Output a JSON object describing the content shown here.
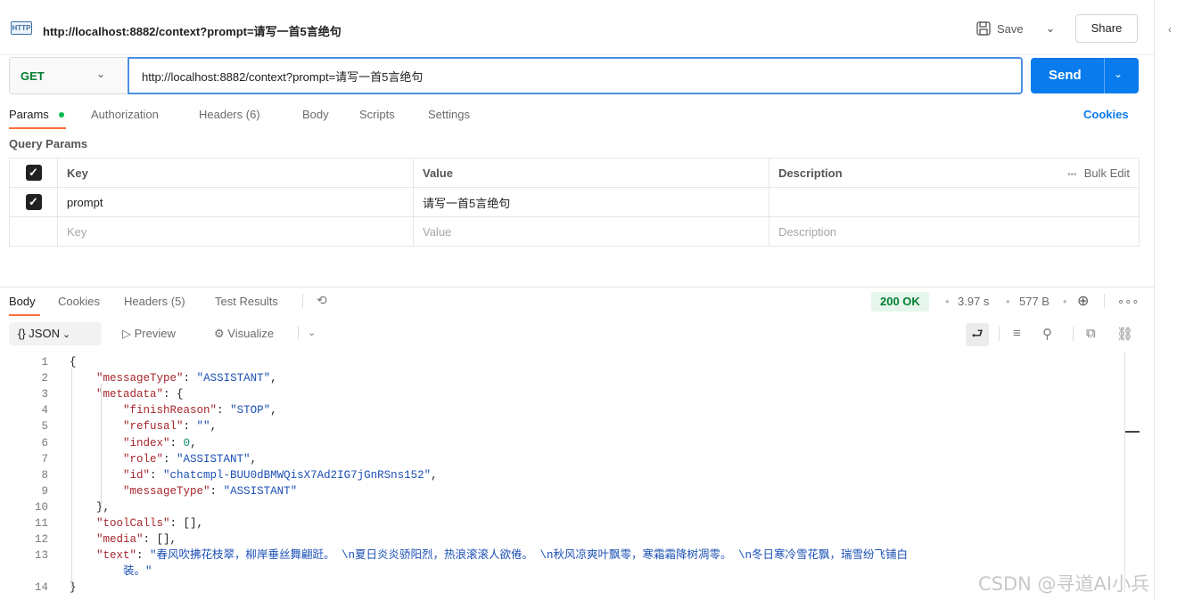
{
  "tab": {
    "icon_text": "HTTP",
    "title": "http://localhost:8882/context?prompt=请写一首5言绝句"
  },
  "header": {
    "save_label": "Save",
    "share_label": "Share"
  },
  "request": {
    "method": "GET",
    "url": "http://localhost:8882/context?prompt=请写一首5言绝句",
    "send_label": "Send"
  },
  "request_tabs": [
    "Params",
    "Authorization",
    "Headers (6)",
    "Body",
    "Scripts",
    "Settings"
  ],
  "cookies_link": "Cookies",
  "query_params": {
    "section_label": "Query Params",
    "headers": {
      "key": "Key",
      "value": "Value",
      "description": "Description",
      "bulk_edit": "Bulk Edit"
    },
    "rows": [
      {
        "checked": true,
        "key": "prompt",
        "value": "请写一首5言绝句",
        "description": ""
      }
    ],
    "placeholders": {
      "key": "Key",
      "value": "Value",
      "description": "Description"
    }
  },
  "response_tabs": [
    "Body",
    "Cookies",
    "Headers (5)",
    "Test Results"
  ],
  "response_meta": {
    "status": "200 OK",
    "time": "3.97 s",
    "size": "577 B"
  },
  "viewer": {
    "format": "JSON",
    "preview_label": "Preview",
    "visualize_label": "Visualize"
  },
  "code_lines": [
    {
      "n": "1",
      "text": "{"
    },
    {
      "n": "2",
      "text": "    \"messageType\": \"ASSISTANT\","
    },
    {
      "n": "3",
      "text": "    \"metadata\": {"
    },
    {
      "n": "4",
      "text": "        \"finishReason\": \"STOP\","
    },
    {
      "n": "5",
      "text": "        \"refusal\": \"\","
    },
    {
      "n": "6",
      "text": "        \"index\": 0,"
    },
    {
      "n": "7",
      "text": "        \"role\": \"ASSISTANT\","
    },
    {
      "n": "8",
      "text": "        \"id\": \"chatcmpl-BUU0dBMWQisX7Ad2IG7jGnRSns152\","
    },
    {
      "n": "9",
      "text": "        \"messageType\": \"ASSISTANT\""
    },
    {
      "n": "10",
      "text": "    },"
    },
    {
      "n": "11",
      "text": "    \"toolCalls\": [],"
    },
    {
      "n": "12",
      "text": "    \"media\": [],"
    },
    {
      "n": "13",
      "text": "    \"text\": \"春风吹拂花枝翠，柳岸垂丝舞翩跹。 \\n夏日炎炎骄阳烈，热浪滚滚人欲倦。 \\n秋风凉爽叶飘零，寒霜霜降树凋零。 \\n冬日寒冷雪花飘，瑞雪纷飞铺白"
    },
    {
      "n": "",
      "text": "        装。\""
    },
    {
      "n": "14",
      "text": "}"
    }
  ],
  "watermark": "CSDN @寻道AI小兵"
}
